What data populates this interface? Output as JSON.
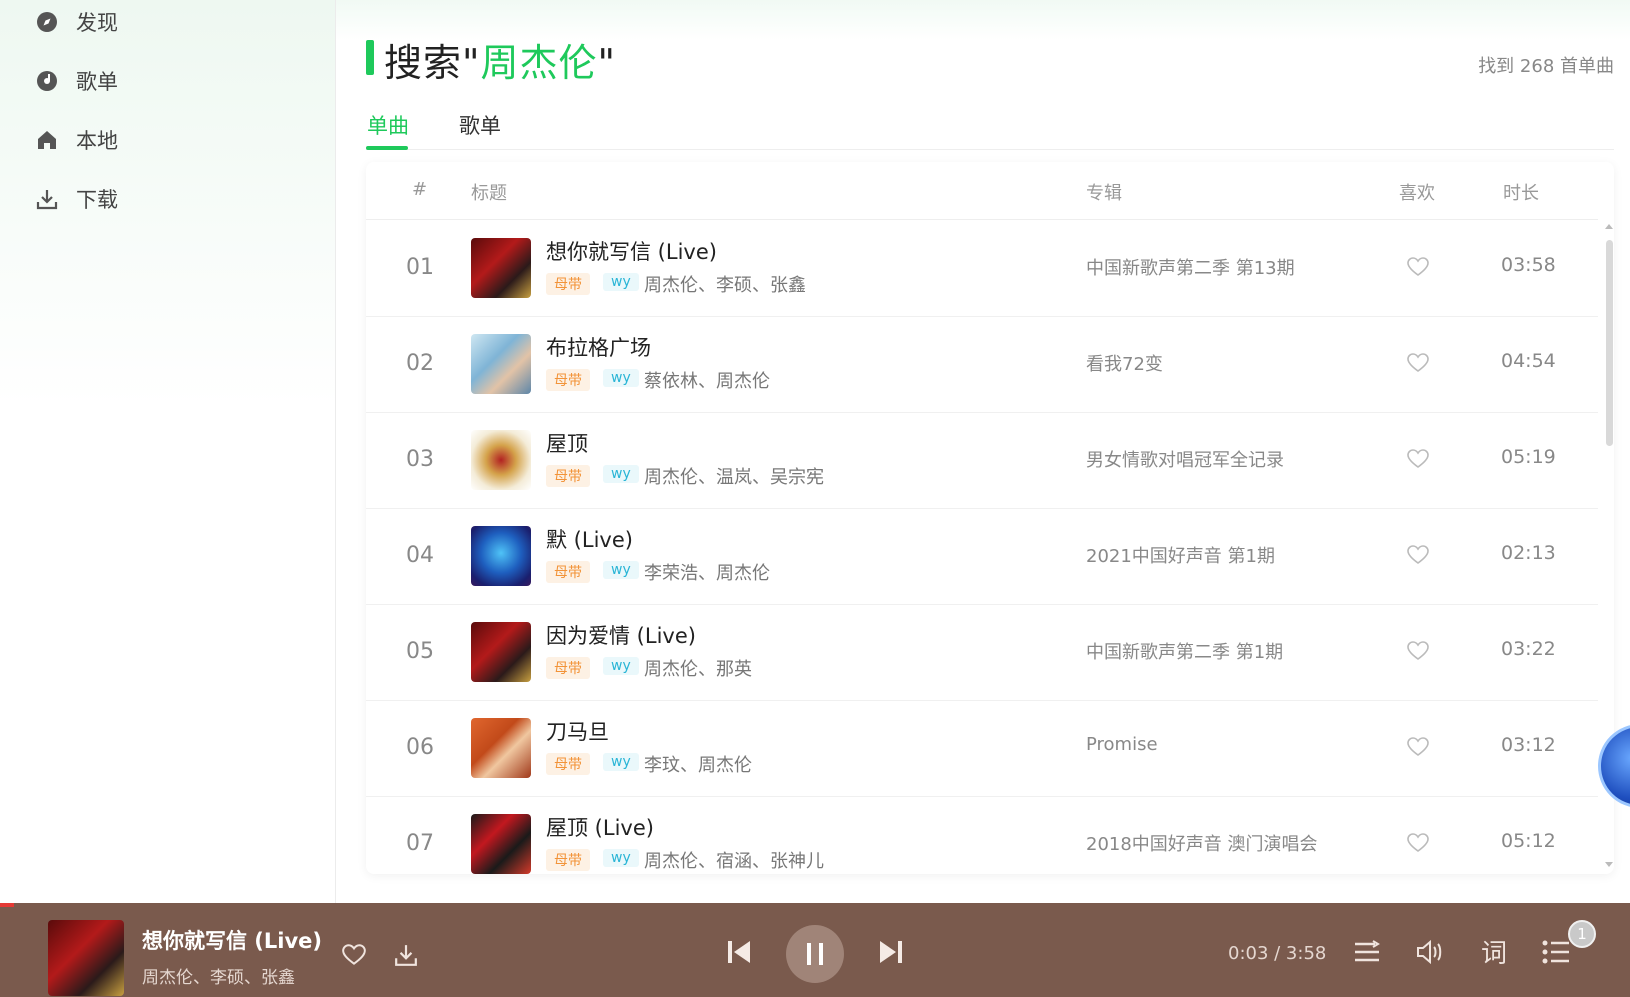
{
  "sidebar": {
    "items": [
      {
        "label": "发现",
        "icon": "compass-icon"
      },
      {
        "label": "歌单",
        "icon": "disc-icon"
      },
      {
        "label": "本地",
        "icon": "home-icon"
      },
      {
        "label": "下载",
        "icon": "download-icon"
      }
    ]
  },
  "search": {
    "prefix": "搜索\"",
    "keyword": "周杰伦",
    "suffix": "\"",
    "count_text": "找到 268 首单曲"
  },
  "tabs": [
    {
      "label": "单曲",
      "active": true
    },
    {
      "label": "歌单",
      "active": false
    }
  ],
  "table": {
    "headers": {
      "index": "#",
      "title": "标题",
      "album": "专辑",
      "like": "喜欢",
      "duration": "时长"
    },
    "tag_mu": "母带",
    "tag_wy": "wy",
    "rows": [
      {
        "index": "01",
        "title": "想你就写信 (Live)",
        "artists": "周杰伦、李硕、张鑫",
        "album": "中国新歌声第二季 第13期",
        "duration": "03:58"
      },
      {
        "index": "02",
        "title": "布拉格广场",
        "artists": "蔡依林、周杰伦",
        "album": "看我72变",
        "duration": "04:54"
      },
      {
        "index": "03",
        "title": "屋顶",
        "artists": "周杰伦、温岚、吴宗宪",
        "album": "男女情歌对唱冠军全记录",
        "duration": "05:19"
      },
      {
        "index": "04",
        "title": "默 (Live)",
        "artists": "李荣浩、周杰伦",
        "album": "2021中国好声音 第1期",
        "duration": "02:13"
      },
      {
        "index": "05",
        "title": "因为爱情 (Live)",
        "artists": "周杰伦、那英",
        "album": "中国新歌声第二季 第1期",
        "duration": "03:22"
      },
      {
        "index": "06",
        "title": "刀马旦",
        "artists": "李玟、周杰伦",
        "album": "Promise",
        "duration": "03:12"
      },
      {
        "index": "07",
        "title": "屋顶 (Live)",
        "artists": "周杰伦、宿涵、张神儿",
        "album": "2018中国好声音 澳门演唱会",
        "duration": "05:12"
      }
    ]
  },
  "player": {
    "title": "想你就写信 (Live)",
    "artists": "周杰伦、李硕、张鑫",
    "time": "0:03 / 3:58",
    "progress": 0.013,
    "playlist_count": "1",
    "lyrics_label": "词"
  },
  "colors": {
    "accent": "#1ec95b",
    "player_bg": "#7a5a4d",
    "tag_mu": "#f29338",
    "tag_wy": "#2ab5d6"
  }
}
